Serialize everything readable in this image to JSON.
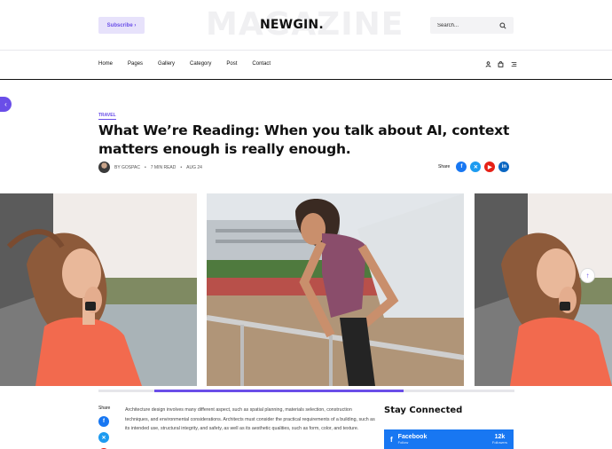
{
  "header": {
    "subscribe_label": "Subscribe ›",
    "logo_background_text": "MAGAZINE",
    "logo": "NEWGIN.",
    "search_placeholder": "Search..."
  },
  "nav": {
    "items": [
      "Home",
      "Pages",
      "Gallery",
      "Category",
      "Post",
      "Contact"
    ]
  },
  "article": {
    "category": "TRAVEL",
    "title": "What We’re Reading: When you talk about AI, context matters enough is really enough.",
    "author": "BY GOSPAC",
    "read_time": "7 MIN READ",
    "date": "AUG 24",
    "share_label": "Share"
  },
  "gallery": {
    "progress": 0.6
  },
  "body": {
    "share_label": "Share",
    "text": "Architecture design involves many different aspect, such as spatial planning, materials selection, construction techniques, and environmental considerations. Architects must consider the practical requirements of a building, such as its intended use, structural integrity, and safety, as well as its aesthetic qualities, such as form, color, and texture."
  },
  "sidebar": {
    "stay_connected": "Stay Connected",
    "facebook": {
      "name": "Facebook",
      "sub": "Follow",
      "count": "12k",
      "count_label": "Followers"
    }
  },
  "colors": {
    "accent": "#6a4ee8",
    "facebook": "#1877f2",
    "twitter": "#1d9bf0",
    "youtube": "#e62117",
    "linkedin": "#0a66c2"
  }
}
